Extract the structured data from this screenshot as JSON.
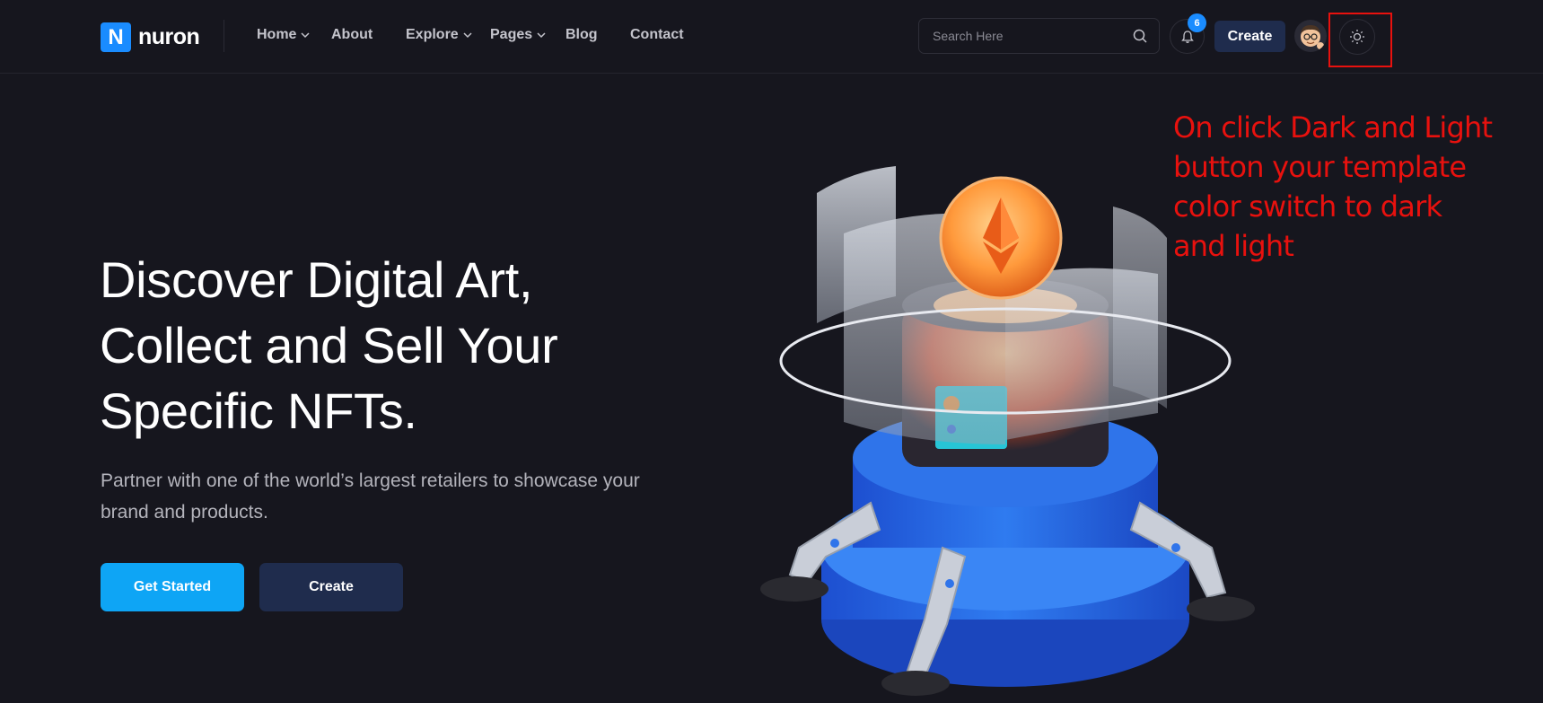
{
  "brand": {
    "logo_letter": "N",
    "name": "nuron",
    "accent": "#1a8cff"
  },
  "nav": {
    "items": [
      {
        "label": "Home",
        "has_dropdown": true
      },
      {
        "label": "About",
        "has_dropdown": false
      },
      {
        "label": "Explore",
        "has_dropdown": true
      },
      {
        "label": "Pages",
        "has_dropdown": true
      },
      {
        "label": "Blog",
        "has_dropdown": false
      },
      {
        "label": "Contact",
        "has_dropdown": false
      }
    ]
  },
  "header": {
    "search_placeholder": "Search Here",
    "notification_count": "6",
    "create_label": "Create",
    "theme_toggle_icon": "sun-icon"
  },
  "hero": {
    "title_lines": [
      "Discover Digital Art,",
      "Collect and Sell Your",
      "Specific NFTs."
    ],
    "subtitle": "Partner with one of the world’s largest retailers to showcase your brand and products.",
    "primary_button": "Get Started",
    "secondary_button": "Create",
    "primary_color": "#0ea5f5",
    "secondary_color": "#1f2c4d"
  },
  "annotation": {
    "text": "On click Dark and Light button your template color switch to dark and light",
    "color": "#e8110e"
  }
}
